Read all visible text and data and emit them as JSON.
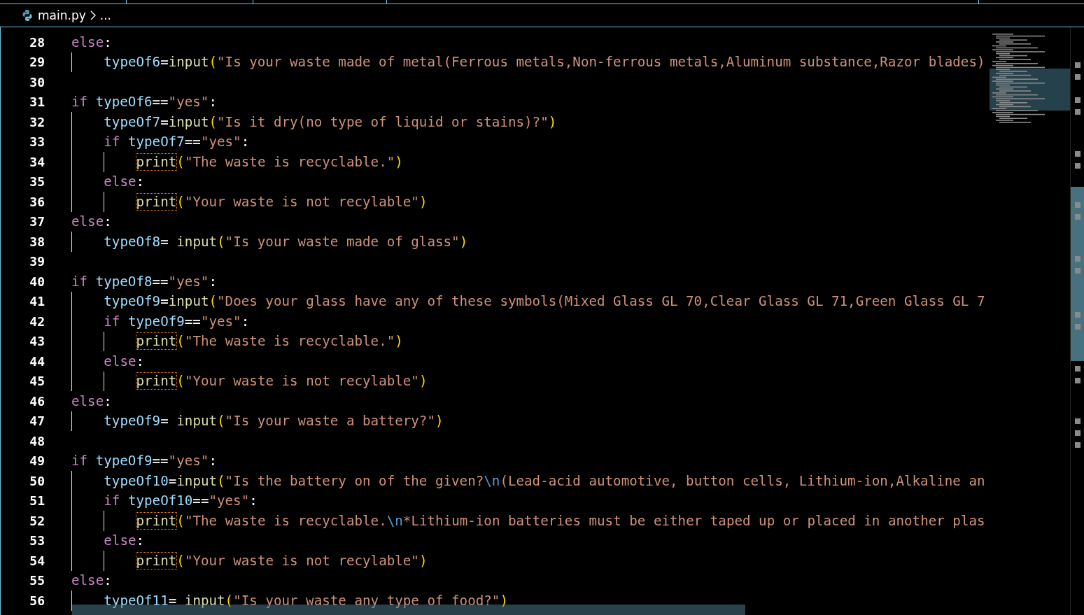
{
  "breadcrumb": {
    "file": "main.py",
    "rest": "..."
  },
  "lines": [
    {
      "number": "28",
      "tokens": [
        {
          "kind": "keyword",
          "text": "else"
        },
        {
          "kind": "plain",
          "text": ":"
        }
      ],
      "children": [
        {
          "number": "29",
          "tokens": [
            {
              "kind": "variable",
              "text": "typeOf6"
            },
            {
              "kind": "plain",
              "text": "="
            },
            {
              "kind": "function",
              "text": "input"
            },
            {
              "kind": "paren",
              "text": "("
            },
            {
              "kind": "string",
              "text": "\"Is your waste made of metal(Ferrous metals,Non-ferrous metals,Aluminum substance,Razor blades)"
            }
          ]
        }
      ]
    },
    {
      "number": "30"
    },
    {
      "number": "31",
      "tokens": [
        {
          "kind": "keyword",
          "text": "if"
        },
        {
          "kind": "variable",
          "text": "typeOf6"
        },
        {
          "kind": "plain",
          "text": "=="
        },
        {
          "kind": "string",
          "text": "\"yes\""
        },
        {
          "kind": "plain",
          "text": ":"
        }
      ],
      "children": [
        {
          "number": "32",
          "tokens": [
            {
              "kind": "variable",
              "text": "typeOf7"
            },
            {
              "kind": "plain",
              "text": "="
            },
            {
              "kind": "function",
              "text": "input"
            },
            {
              "kind": "paren",
              "text": "("
            },
            {
              "kind": "string",
              "text": "\"Is it dry(no type of liquid or stains)?\""
            },
            {
              "kind": "paren",
              "text": ")"
            }
          ]
        },
        {
          "number": "33",
          "tokens": [
            {
              "kind": "keyword",
              "text": "if"
            },
            {
              "kind": "variable",
              "text": "typeOf7"
            },
            {
              "kind": "plain",
              "text": "=="
            },
            {
              "kind": "string",
              "text": "\"yes\""
            },
            {
              "kind": "plain",
              "text": ":"
            }
          ],
          "children": [
            {
              "number": "34",
              "tokens": [
                {
                  "kind": "print",
                  "text": "print"
                },
                {
                  "kind": "paren",
                  "text": "("
                },
                {
                  "kind": "string",
                  "text": "\"The waste is recyclable.\""
                },
                {
                  "kind": "paren",
                  "text": ")"
                }
              ]
            }
          ]
        },
        {
          "number": "35",
          "tokens": [
            {
              "kind": "keyword",
              "text": "else"
            },
            {
              "kind": "plain",
              "text": ":"
            }
          ],
          "children": [
            {
              "number": "36",
              "tokens": [
                {
                  "kind": "print",
                  "text": "print"
                },
                {
                  "kind": "paren",
                  "text": "("
                },
                {
                  "kind": "string",
                  "text": "\"Your waste is not recylable\""
                },
                {
                  "kind": "paren",
                  "text": ")"
                }
              ]
            }
          ]
        }
      ]
    },
    {
      "number": "37",
      "tokens": [
        {
          "kind": "keyword",
          "text": "else"
        },
        {
          "kind": "plain",
          "text": ":"
        }
      ],
      "children": [
        {
          "number": "38",
          "tokens": [
            {
              "kind": "variable",
              "text": "typeOf8"
            },
            {
              "kind": "plain",
              "text": "= "
            },
            {
              "kind": "function",
              "text": "input"
            },
            {
              "kind": "paren",
              "text": "("
            },
            {
              "kind": "string",
              "text": "\"Is your waste made of glass\""
            },
            {
              "kind": "paren",
              "text": ")"
            }
          ]
        }
      ]
    },
    {
      "number": "39"
    },
    {
      "number": "40",
      "tokens": [
        {
          "kind": "keyword",
          "text": "if"
        },
        {
          "kind": "variable",
          "text": "typeOf8"
        },
        {
          "kind": "plain",
          "text": "=="
        },
        {
          "kind": "string",
          "text": "\"yes\""
        },
        {
          "kind": "plain",
          "text": ":"
        }
      ],
      "children": [
        {
          "number": "41",
          "tokens": [
            {
              "kind": "variable",
              "text": "typeOf9"
            },
            {
              "kind": "plain",
              "text": "="
            },
            {
              "kind": "function",
              "text": "input"
            },
            {
              "kind": "paren",
              "text": "("
            },
            {
              "kind": "string",
              "text": "\"Does your glass have any of these symbols(Mixed Glass GL 70,Clear Glass GL 71,Green Glass GL 7"
            }
          ]
        },
        {
          "number": "42",
          "tokens": [
            {
              "kind": "keyword",
              "text": "if"
            },
            {
              "kind": "variable",
              "text": "typeOf9"
            },
            {
              "kind": "plain",
              "text": "=="
            },
            {
              "kind": "string",
              "text": "\"yes\""
            },
            {
              "kind": "plain",
              "text": ":"
            }
          ],
          "children": [
            {
              "number": "43",
              "tokens": [
                {
                  "kind": "print",
                  "text": "print"
                },
                {
                  "kind": "paren",
                  "text": "("
                },
                {
                  "kind": "string",
                  "text": "\"The waste is recyclable.\""
                },
                {
                  "kind": "paren",
                  "text": ")"
                }
              ]
            }
          ]
        },
        {
          "number": "44",
          "tokens": [
            {
              "kind": "keyword",
              "text": "else"
            },
            {
              "kind": "plain",
              "text": ":"
            }
          ],
          "children": [
            {
              "number": "45",
              "tokens": [
                {
                  "kind": "print",
                  "text": "print"
                },
                {
                  "kind": "paren",
                  "text": "("
                },
                {
                  "kind": "string",
                  "text": "\"Your waste is not recylable\""
                },
                {
                  "kind": "paren",
                  "text": ")"
                }
              ]
            }
          ]
        }
      ]
    },
    {
      "number": "46",
      "tokens": [
        {
          "kind": "keyword",
          "text": "else"
        },
        {
          "kind": "plain",
          "text": ":"
        }
      ],
      "children": [
        {
          "number": "47",
          "tokens": [
            {
              "kind": "variable",
              "text": "typeOf9"
            },
            {
              "kind": "plain",
              "text": "= "
            },
            {
              "kind": "function",
              "text": "input"
            },
            {
              "kind": "paren",
              "text": "("
            },
            {
              "kind": "string",
              "text": "\"Is your waste a battery?\""
            },
            {
              "kind": "paren",
              "text": ")"
            }
          ]
        }
      ]
    },
    {
      "number": "48"
    },
    {
      "number": "49",
      "tokens": [
        {
          "kind": "keyword",
          "text": "if"
        },
        {
          "kind": "variable",
          "text": "typeOf9"
        },
        {
          "kind": "plain",
          "text": "=="
        },
        {
          "kind": "string",
          "text": "\"yes\""
        },
        {
          "kind": "plain",
          "text": ":"
        }
      ],
      "children": [
        {
          "number": "50",
          "tokens": [
            {
              "kind": "variable",
              "text": "typeOf10"
            },
            {
              "kind": "plain",
              "text": "="
            },
            {
              "kind": "function",
              "text": "input"
            },
            {
              "kind": "paren",
              "text": "("
            },
            {
              "kind": "string",
              "text": "\"Is the battery on of the given?"
            },
            {
              "kind": "escape",
              "text": "\\n"
            },
            {
              "kind": "string",
              "text": "(Lead-acid automotive, button cells, Lithium-ion,Alkaline an"
            }
          ]
        },
        {
          "number": "51",
          "tokens": [
            {
              "kind": "keyword",
              "text": "if"
            },
            {
              "kind": "variable",
              "text": "typeOf10"
            },
            {
              "kind": "plain",
              "text": "=="
            },
            {
              "kind": "string",
              "text": "\"yes\""
            },
            {
              "kind": "plain",
              "text": ":"
            }
          ],
          "children": [
            {
              "number": "52",
              "tokens": [
                {
                  "kind": "print",
                  "text": "print"
                },
                {
                  "kind": "paren",
                  "text": "("
                },
                {
                  "kind": "string",
                  "text": "\"The waste is recyclable."
                },
                {
                  "kind": "escape",
                  "text": "\\n"
                },
                {
                  "kind": "string",
                  "text": "*Lithium-ion batteries must be either taped up or placed in another plas"
                }
              ]
            }
          ]
        },
        {
          "number": "53",
          "tokens": [
            {
              "kind": "keyword",
              "text": "else"
            },
            {
              "kind": "plain",
              "text": ":"
            }
          ],
          "children": [
            {
              "number": "54",
              "tokens": [
                {
                  "kind": "print",
                  "text": "print"
                },
                {
                  "kind": "paren",
                  "text": "("
                },
                {
                  "kind": "string",
                  "text": "\"Your waste is not recylable\""
                },
                {
                  "kind": "paren",
                  "text": ")"
                }
              ]
            }
          ]
        }
      ]
    },
    {
      "number": "55",
      "tokens": [
        {
          "kind": "keyword",
          "text": "else"
        },
        {
          "kind": "plain",
          "text": ":"
        }
      ],
      "children": [
        {
          "number": "56",
          "tokens": [
            {
              "kind": "variable",
              "text": "typeOf11"
            },
            {
              "kind": "plain",
              "text": "= "
            },
            {
              "kind": "function",
              "text": "input"
            },
            {
              "kind": "paren",
              "text": "("
            },
            {
              "kind": "string",
              "text": "\"Is your waste any type of food?\""
            },
            {
              "kind": "paren",
              "text": ")"
            }
          ]
        }
      ]
    }
  ]
}
